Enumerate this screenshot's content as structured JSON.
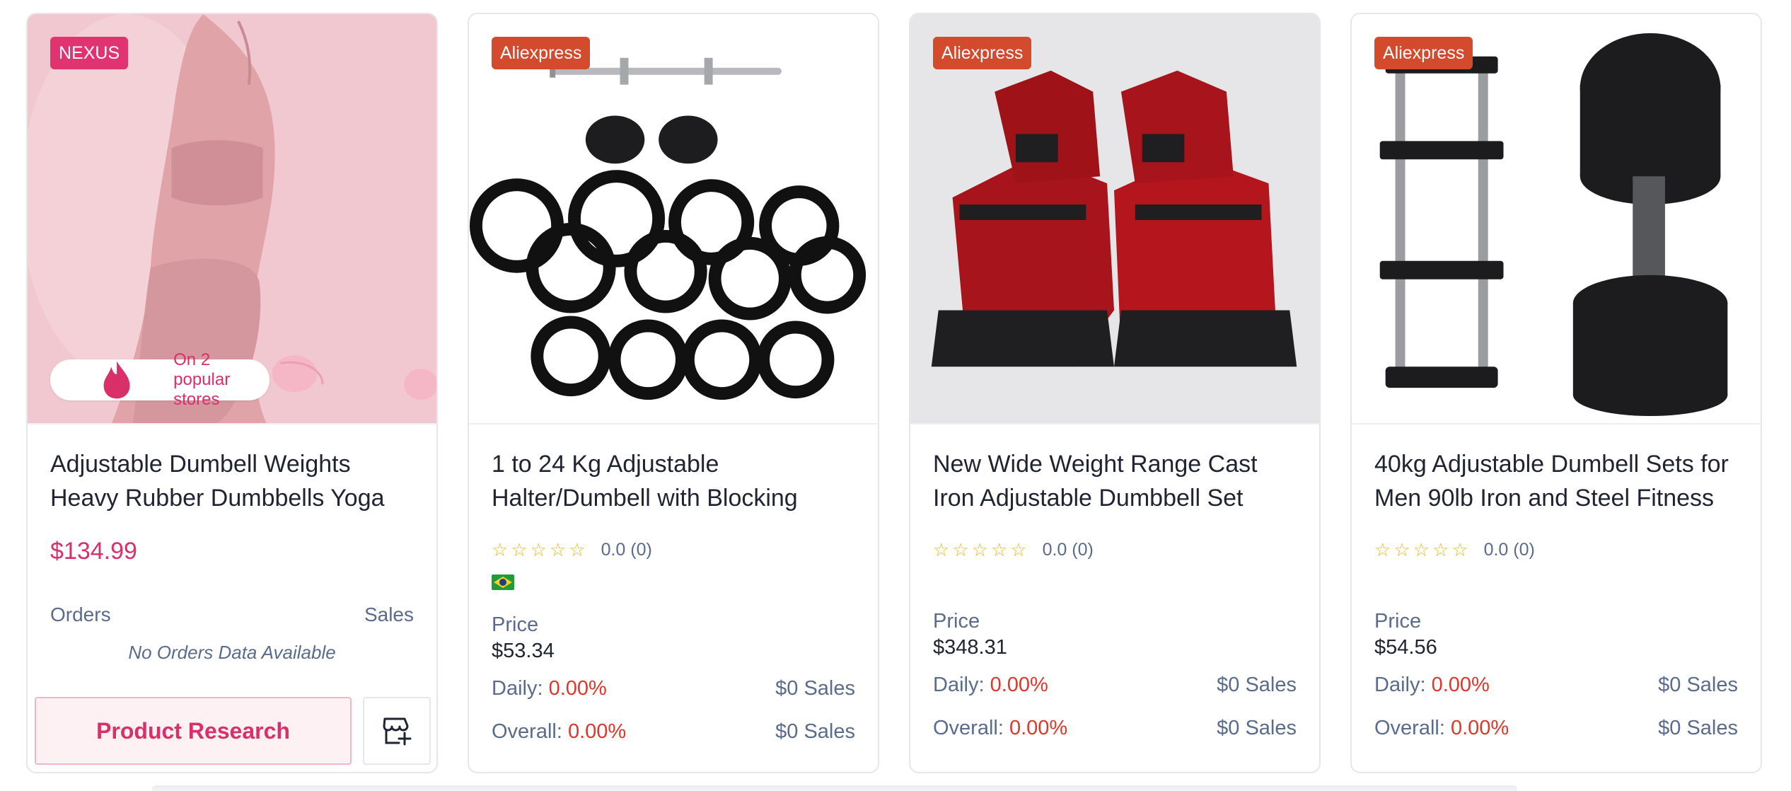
{
  "cards": [
    {
      "source": "NEXUS",
      "popular": "On 2 popular stores",
      "title": "Adjustable Dumbell Weights Heavy Rubber Dumbbells Yoga",
      "price": "$134.99",
      "orders_label": "Orders",
      "sales_label": "Sales",
      "no_orders": "No Orders Data Available",
      "research_button": "Product Research"
    },
    {
      "source": "Aliexpress",
      "title": "1 to 24 Kg Adjustable Halter/Dumbell with Blocking",
      "rating": "0.0 (0)",
      "stars": 0,
      "price_label": "Price",
      "price": "$53.34",
      "daily_label": "Daily:",
      "daily_pct": "0.00%",
      "daily_sales": "$0 Sales",
      "overall_label": "Overall:",
      "overall_pct": "0.00%",
      "overall_sales": "$0 Sales"
    },
    {
      "source": "Aliexpress",
      "title": "New Wide Weight Range Cast Iron Adjustable Dumbbell Set",
      "rating": "0.0 (0)",
      "stars": 0,
      "price_label": "Price",
      "price": "$348.31",
      "daily_label": "Daily:",
      "daily_pct": "0.00%",
      "daily_sales": "$0 Sales",
      "overall_label": "Overall:",
      "overall_pct": "0.00%",
      "overall_sales": "$0 Sales"
    },
    {
      "source": "Aliexpress",
      "title": "40kg Adjustable Dumbell Sets for Men 90lb Iron and Steel Fitness",
      "rating": "0.0 (0)",
      "stars": 0,
      "price_label": "Price",
      "price": "$54.56",
      "daily_label": "Daily:",
      "daily_pct": "0.00%",
      "daily_sales": "$0 Sales",
      "overall_label": "Overall:",
      "overall_pct": "0.00%",
      "overall_sales": "$0 Sales"
    }
  ],
  "icons": {
    "flame": "flame-icon",
    "store_add": "store-add-icon",
    "star_empty": "☆",
    "flag": "brazil-flag-icon"
  },
  "colors": {
    "nexus_badge": "#e0336f",
    "aliexpress_badge": "#d34a2c",
    "accent_pink": "#d9306a",
    "percent_red": "#e0362b",
    "star_yellow": "#e8b923"
  }
}
